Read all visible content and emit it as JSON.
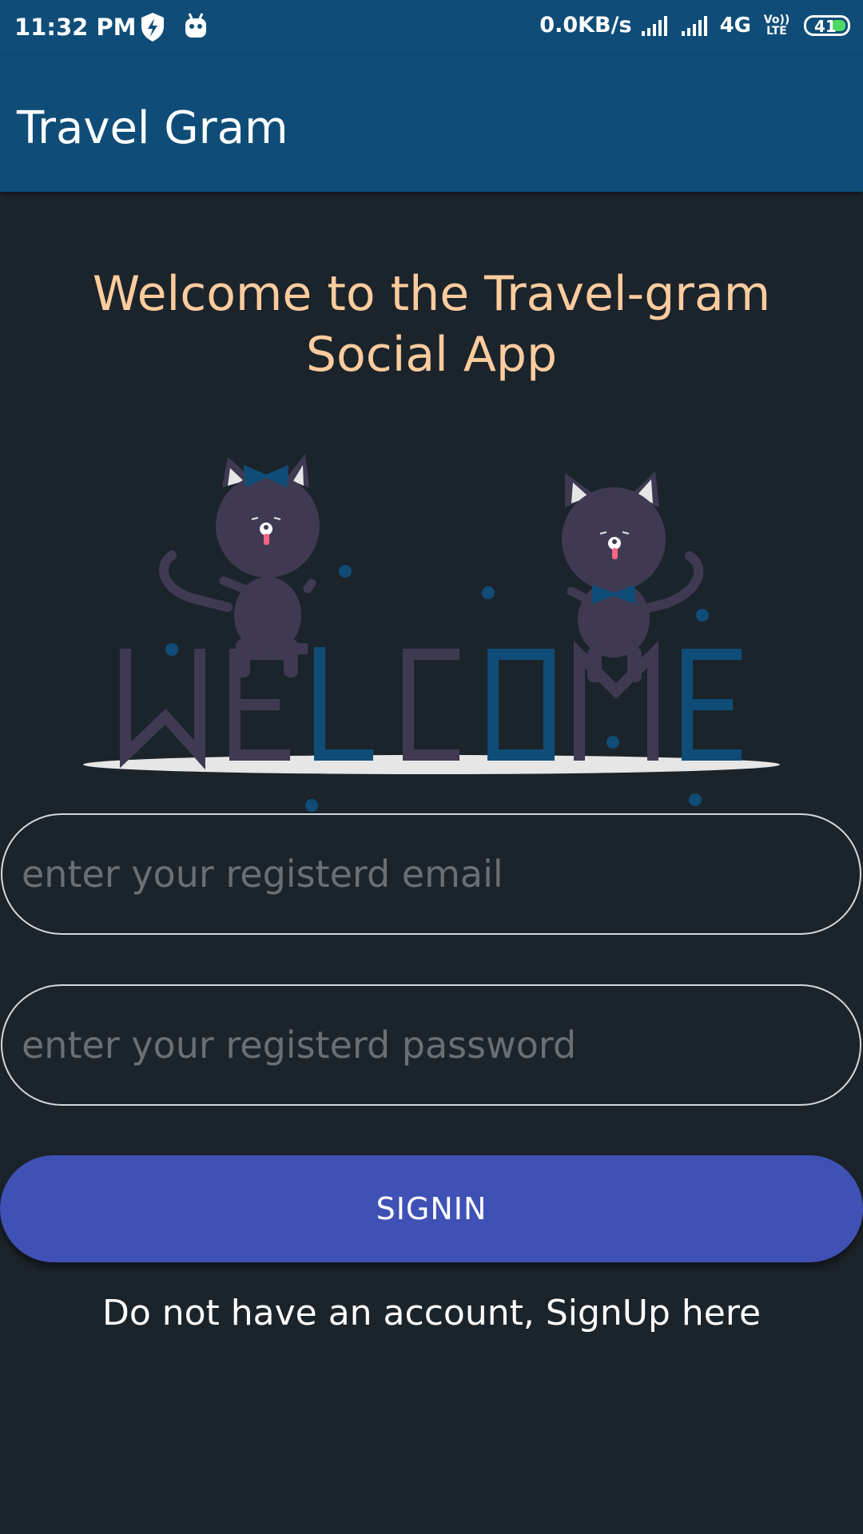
{
  "status_bar": {
    "time": "11:32 PM",
    "net_speed": "0.0KB/s",
    "network_type": "4G",
    "volte_label": "Vo)) LTE",
    "battery_level": "41",
    "icons": [
      "shield-bolt-icon",
      "android-debug-icon",
      "signal-icon",
      "signal-icon",
      "battery-icon"
    ]
  },
  "app_bar": {
    "title": "Travel Gram"
  },
  "main": {
    "welcome_text": "Welcome to the Travel-gram Social App",
    "illustration_word": "WELCOME",
    "email": {
      "placeholder": "enter your registerd email",
      "value": ""
    },
    "password": {
      "placeholder": "enter your registerd password",
      "value": ""
    },
    "signin_label": "SIGNIN",
    "signup_text": "Do not have an account, SignUp here"
  },
  "colors": {
    "app_bar": "#0f4d78",
    "background": "#1c242b",
    "heading": "#ffcc9e",
    "button": "#3f51b5",
    "illustration_dark": "#3f3a52",
    "illustration_blue": "#0f4d78"
  }
}
